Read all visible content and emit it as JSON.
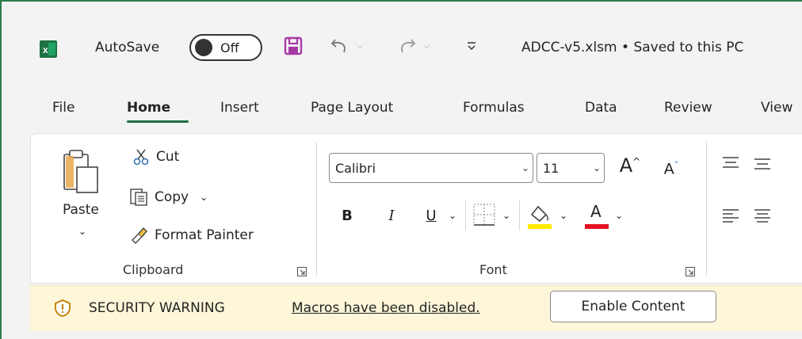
{
  "titlebar": {
    "autosave_label": "AutoSave",
    "autosave_state": "Off",
    "document_title": "ADCC-v5.xlsm • Saved to this PC"
  },
  "tabs": [
    {
      "label": "File"
    },
    {
      "label": "Home"
    },
    {
      "label": "Insert"
    },
    {
      "label": "Page Layout"
    },
    {
      "label": "Formulas"
    },
    {
      "label": "Data"
    },
    {
      "label": "Review"
    },
    {
      "label": "View"
    }
  ],
  "active_tab": "Home",
  "clipboard": {
    "paste_label": "Paste",
    "cut_label": "Cut",
    "copy_label": "Copy",
    "format_painter_label": "Format Painter",
    "group_label": "Clipboard"
  },
  "font": {
    "font_name": "Calibri",
    "font_size": "11",
    "bold_label": "B",
    "italic_label": "I",
    "underline_label": "U",
    "font_color_label": "A",
    "group_label": "Font",
    "highlight_color": "#ffeb00",
    "font_color": "#e81123"
  },
  "security_bar": {
    "title": "SECURITY WARNING",
    "message": "Macros have been disabled.",
    "button_label": "Enable Content"
  },
  "colors": {
    "excel_green": "#1f7244",
    "save_icon_purple": "#a53aa5",
    "warning_bg": "#fdf6d8"
  }
}
